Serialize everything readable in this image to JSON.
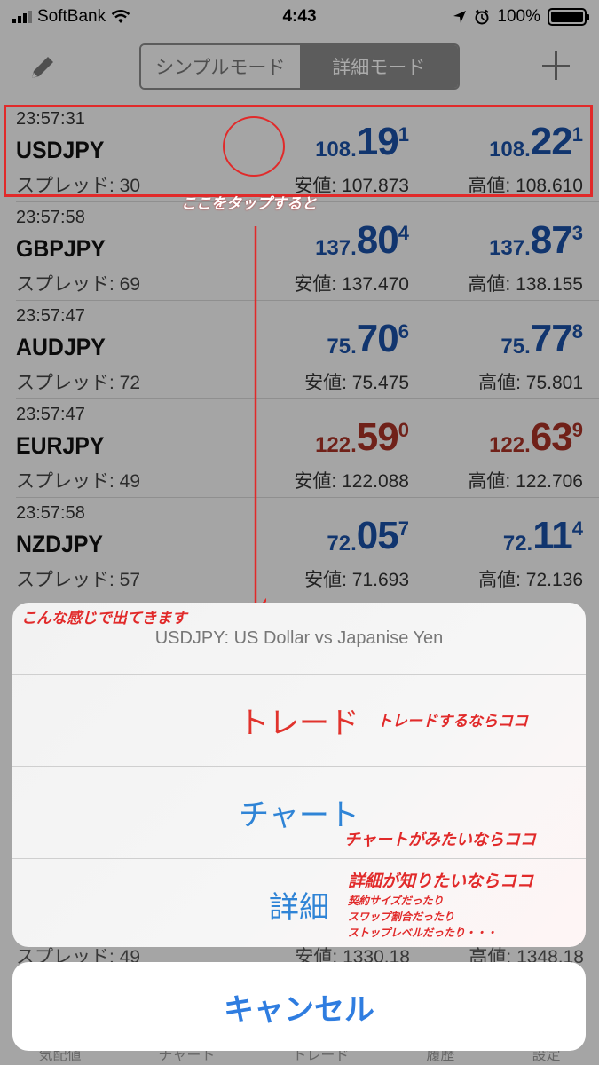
{
  "status_bar": {
    "carrier": "SoftBank",
    "time": "4:43",
    "battery": "100%"
  },
  "toolbar": {
    "mode_simple": "シンプルモード",
    "mode_detail": "詳細モード"
  },
  "quotes": [
    {
      "time": "23:57:31",
      "symbol": "USDJPY",
      "spread": "スプレッド: 30",
      "bid_big": "108.",
      "bid_mid": "19",
      "bid_small": "1",
      "ask_big": "108.",
      "ask_mid": "22",
      "ask_small": "1",
      "low": "安値: 107.873",
      "high": "高値: 108.610",
      "color": "blue"
    },
    {
      "time": "23:57:58",
      "symbol": "GBPJPY",
      "spread": "スプレッド: 69",
      "bid_big": "137.",
      "bid_mid": "80",
      "bid_small": "4",
      "ask_big": "137.",
      "ask_mid": "87",
      "ask_small": "3",
      "low": "安値: 137.470",
      "high": "高値: 138.155",
      "color": "blue"
    },
    {
      "time": "23:57:47",
      "symbol": "AUDJPY",
      "spread": "スプレッド: 72",
      "bid_big": "75.",
      "bid_mid": "70",
      "bid_small": "6",
      "ask_big": "75.",
      "ask_mid": "77",
      "ask_small": "8",
      "low": "安値: 75.475",
      "high": "高値: 75.801",
      "color": "blue"
    },
    {
      "time": "23:57:47",
      "symbol": "EURJPY",
      "spread": "スプレッド: 49",
      "bid_big": "122.",
      "bid_mid": "59",
      "bid_small": "0",
      "ask_big": "122.",
      "ask_mid": "63",
      "ask_small": "9",
      "low": "安値: 122.088",
      "high": "高値: 122.706",
      "color": "red"
    },
    {
      "time": "23:57:58",
      "symbol": "NZDJPY",
      "spread": "スプレッド: 57",
      "bid_big": "72.",
      "bid_mid": "05",
      "bid_small": "7",
      "ask_big": "72.",
      "ask_mid": "11",
      "ask_small": "4",
      "low": "安値: 71.693",
      "high": "高値: 72.136",
      "color": "blue"
    }
  ],
  "ghost_row": {
    "spread": "スプレッド: 49",
    "low": "安値: 1330.18",
    "high": "高値: 1348.18"
  },
  "tabs": [
    "気配値",
    "チャート",
    "トレード",
    "履歴",
    "設定"
  ],
  "action_sheet": {
    "title": "USDJPY: US Dollar vs Japanise Yen",
    "trade": "トレード",
    "chart": "チャート",
    "detail": "詳細",
    "cancel": "キャンセル"
  },
  "annotations": {
    "tap_here": "ここをタップすると",
    "appears": "こんな感じで出てきます",
    "trade_note": "トレードするならココ",
    "chart_note": "チャートがみたいならココ",
    "detail_note": "詳細が知りたいならココ",
    "detail_sub1": "契約サイズだったり",
    "detail_sub2": "スワップ割合だったり",
    "detail_sub3": "ストップレベルだったり・・・"
  },
  "colors": {
    "bid_blue": "#1a4fa5",
    "price_red": "#a83226",
    "annotation_red": "#e12a2a",
    "ios_blue": "#2f84d6"
  }
}
